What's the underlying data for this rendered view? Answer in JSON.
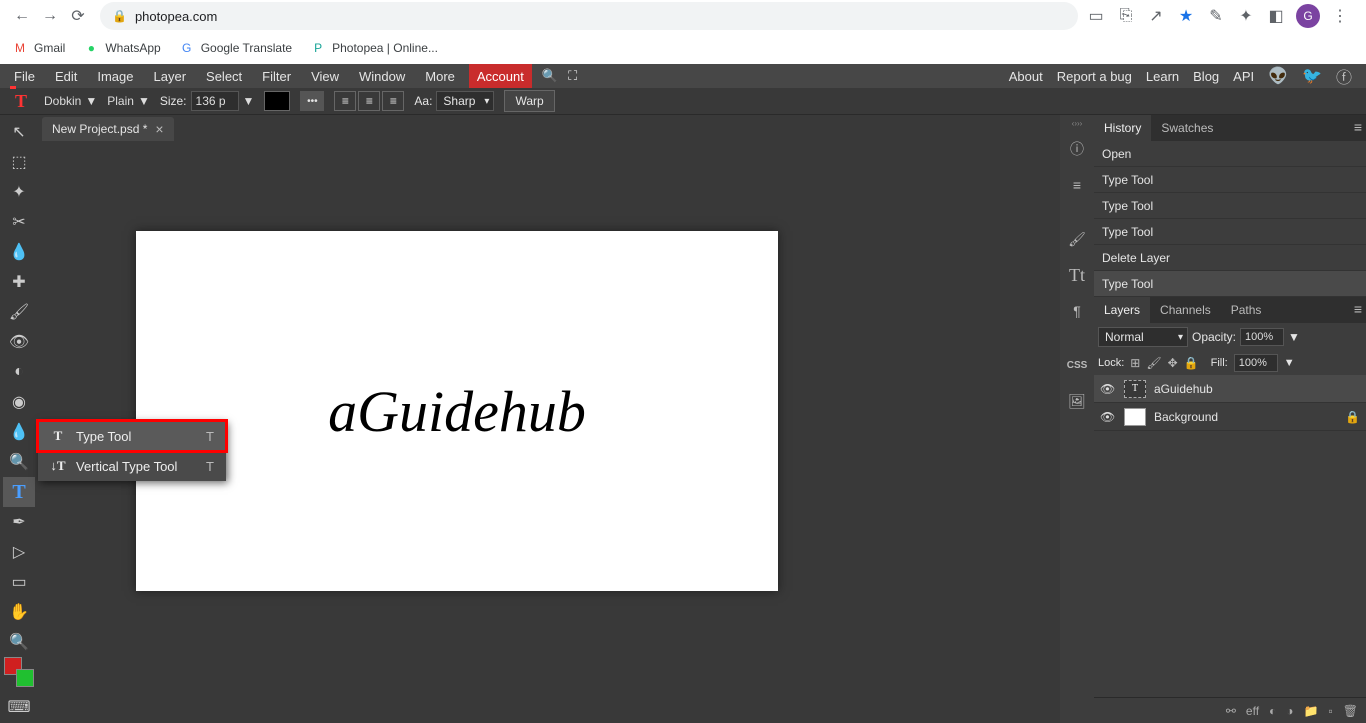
{
  "browser": {
    "url": "photopea.com",
    "avatar_letter": "G"
  },
  "bookmarks": [
    {
      "icon": "M",
      "label": "Gmail",
      "color": "#ea4335"
    },
    {
      "icon": "●",
      "label": "WhatsApp",
      "color": "#25d366"
    },
    {
      "icon": "G",
      "label": "Google Translate",
      "color": "#4285f4"
    },
    {
      "icon": "P",
      "label": "Photopea | Online...",
      "color": "#18a497"
    }
  ],
  "menu": [
    "File",
    "Edit",
    "Image",
    "Layer",
    "Select",
    "Filter",
    "View",
    "Window",
    "More"
  ],
  "menu_account": "Account",
  "menu_right": [
    "About",
    "Report a bug",
    "Learn",
    "Blog",
    "API"
  ],
  "options": {
    "font": "Dobkin",
    "style": "Plain",
    "size_label": "Size:",
    "size_value": "136 p",
    "aa_label": "Aa:",
    "aa_value": "Sharp",
    "warp": "Warp"
  },
  "doc_tab": "New Project.psd *",
  "canvas_text": "aGuidehub",
  "flyout": [
    {
      "label": "Type Tool",
      "shortcut": "T"
    },
    {
      "label": "Vertical Type Tool",
      "shortcut": "T"
    }
  ],
  "panels": {
    "hist_tabs": [
      "History",
      "Swatches"
    ],
    "history": [
      "Open",
      "Type Tool",
      "Type Tool",
      "Type Tool",
      "Delete Layer",
      "Type Tool"
    ],
    "layer_tabs": [
      "Layers",
      "Channels",
      "Paths"
    ],
    "blend": "Normal",
    "opacity_label": "Opacity:",
    "opacity_value": "100%",
    "lock_label": "Lock:",
    "fill_label": "Fill:",
    "fill_value": "100%",
    "layers": [
      {
        "name": "aGuidehub",
        "type": "text"
      },
      {
        "name": "Background",
        "type": "raster",
        "locked": true
      }
    ]
  }
}
